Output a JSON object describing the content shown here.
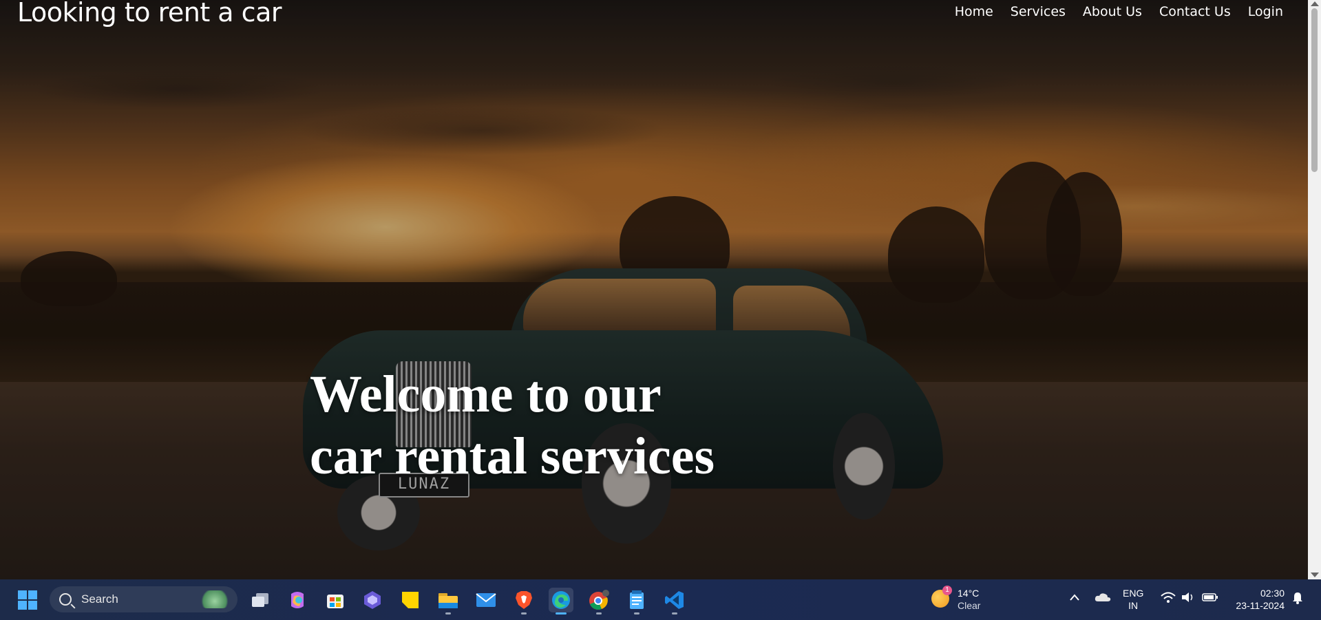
{
  "site": {
    "brand": "Looking to rent a car",
    "nav": [
      "Home",
      "Services",
      "About Us",
      "Contact Us",
      "Login"
    ],
    "hero_line1": "Welcome to our",
    "hero_line2": "car rental services",
    "plate_text": "LUNAZ"
  },
  "taskbar": {
    "search_placeholder": "Search",
    "apps": [
      {
        "icon": "windows-start-icon"
      },
      {
        "icon": "task-view-icon"
      },
      {
        "icon": "copilot-icon"
      },
      {
        "icon": "microsoft-store-icon"
      },
      {
        "icon": "app-hexagon-icon"
      },
      {
        "icon": "sticky-notes-icon"
      },
      {
        "icon": "file-explorer-icon"
      },
      {
        "icon": "mail-icon"
      },
      {
        "icon": "brave-browser-icon"
      },
      {
        "icon": "edge-browser-icon"
      },
      {
        "icon": "chrome-browser-icon"
      },
      {
        "icon": "notepad-icon"
      },
      {
        "icon": "vscode-icon"
      }
    ],
    "weather_temp": "14°C",
    "weather_desc": "Clear",
    "weather_badge": "1",
    "lang_line1": "ENG",
    "lang_line2": "IN",
    "time": "02:30",
    "date": "23-11-2024"
  },
  "colors": {
    "taskbar_bg": "#1b2a52",
    "accent": "#4fb3ff"
  }
}
